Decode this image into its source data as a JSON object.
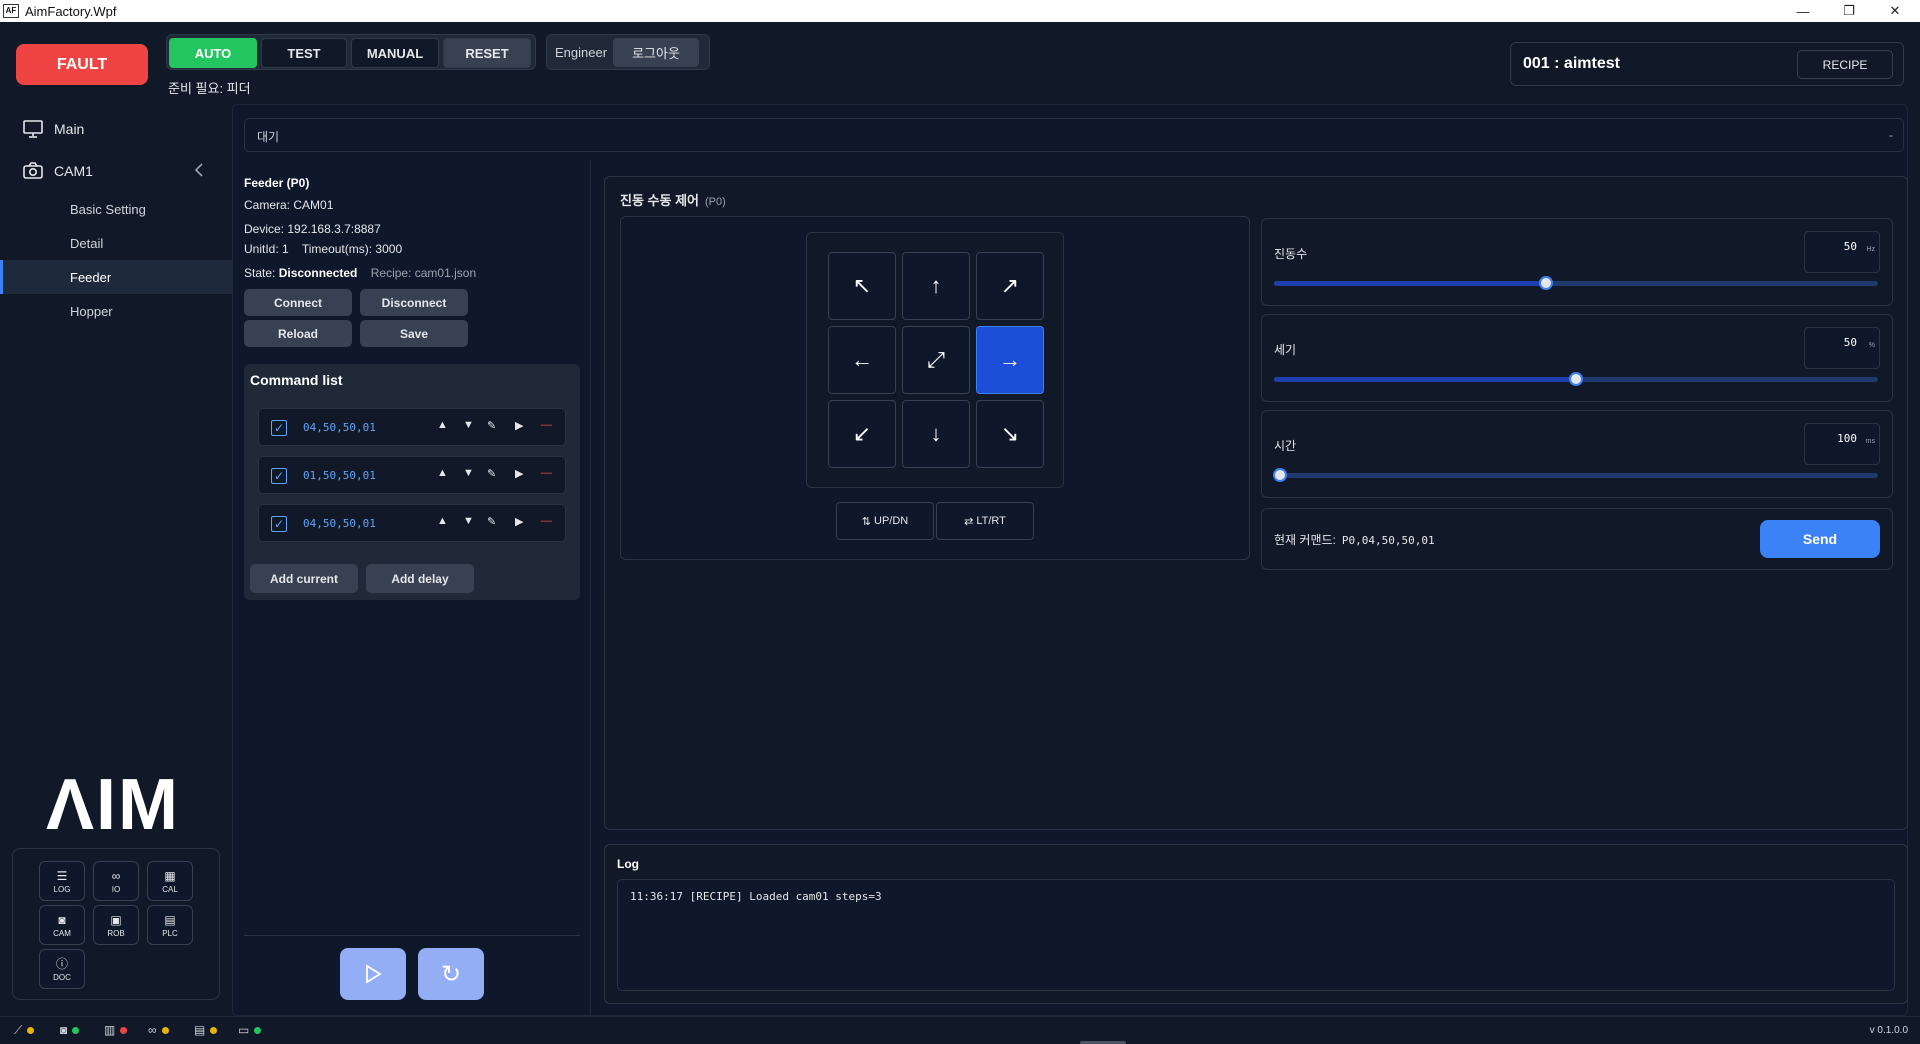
{
  "window": {
    "title": "AimFactory.Wpf",
    "icon_text": "AF",
    "minimize": "—",
    "maximize": "❐",
    "close": "✕"
  },
  "header": {
    "fault_label": "FAULT",
    "modes": {
      "auto": "AUTO",
      "test": "TEST",
      "manual": "MANUAL",
      "reset": "RESET"
    },
    "ready_text": "준비 필요: 피더",
    "role_label": "Engineer",
    "logout_label": "로그아웃",
    "recipe_name": "001 : aimtest",
    "recipe_button": "RECIPE"
  },
  "sidebar": {
    "main_label": "Main",
    "cam_label": "CAM1",
    "sub_items": [
      "Basic Setting",
      "Detail",
      "Feeder",
      "Hopper"
    ],
    "active_item": "Feeder",
    "logo_text": "ΛIM",
    "tools": [
      {
        "label": "LOG",
        "icon": "log-icon"
      },
      {
        "label": "IO",
        "icon": "io-icon"
      },
      {
        "label": "CAL",
        "icon": "calendar-icon"
      },
      {
        "label": "CAM",
        "icon": "camera-icon"
      },
      {
        "label": "ROB",
        "icon": "robot-icon"
      },
      {
        "label": "PLC",
        "icon": "plc-icon"
      },
      {
        "label": "DOC",
        "icon": "info-icon"
      }
    ]
  },
  "status_line": {
    "text": "대기",
    "right": "-"
  },
  "feeder": {
    "title": "Feeder (P0)",
    "camera_label": "Camera:",
    "camera_value": "CAM01",
    "device_label": "Device:",
    "device_value": "192.168.3.7:8887",
    "unit_label": "UnitId:",
    "unit_value": "1",
    "timeout_label": "Timeout(ms):",
    "timeout_value": "3000",
    "state_label": "State:",
    "state_value": "Disconnected",
    "recipe_info": "Recipe: cam01.json",
    "buttons": {
      "connect": "Connect",
      "disconnect": "Disconnect",
      "reload": "Reload",
      "save": "Save"
    },
    "command_list_title": "Command list",
    "commands": [
      {
        "text": "04,50,50,01",
        "checked": true
      },
      {
        "text": "01,50,50,01",
        "checked": true
      },
      {
        "text": "04,50,50,01",
        "checked": true
      }
    ],
    "add_current": "Add current",
    "add_delay": "Add delay"
  },
  "vibration": {
    "title": "진동 수동 제어",
    "subtitle": "(P0)",
    "active_direction": "right",
    "swap_updn": "UP/DN",
    "swap_ltrt": "LT/RT",
    "params": [
      {
        "label": "진동수",
        "value": "50",
        "unit": "Hz",
        "fraction": 0.45
      },
      {
        "label": "세기",
        "value": "50",
        "unit": "%",
        "fraction": 0.5
      },
      {
        "label": "시간",
        "value": "100",
        "unit": "ms",
        "fraction": 0.01
      }
    ],
    "current_command_label": "현재 커맨드:",
    "current_command_value": "P0,04,50,50,01",
    "send_label": "Send"
  },
  "log": {
    "title": "Log",
    "lines": [
      "11:36:17 [RECIPE] Loaded cam01 steps=3"
    ]
  },
  "statusbar": {
    "version": "v 0.1.0.0",
    "indicators": [
      {
        "icon": "robot-arm-icon",
        "color": "#eab308"
      },
      {
        "icon": "camera-icon",
        "color": "#22c55e"
      },
      {
        "icon": "plc-icon",
        "color": "#ef4444"
      },
      {
        "icon": "io-icon",
        "color": "#eab308"
      },
      {
        "icon": "panel-icon",
        "color": "#eab308"
      },
      {
        "icon": "monitor-icon",
        "color": "#22c55e"
      }
    ]
  }
}
